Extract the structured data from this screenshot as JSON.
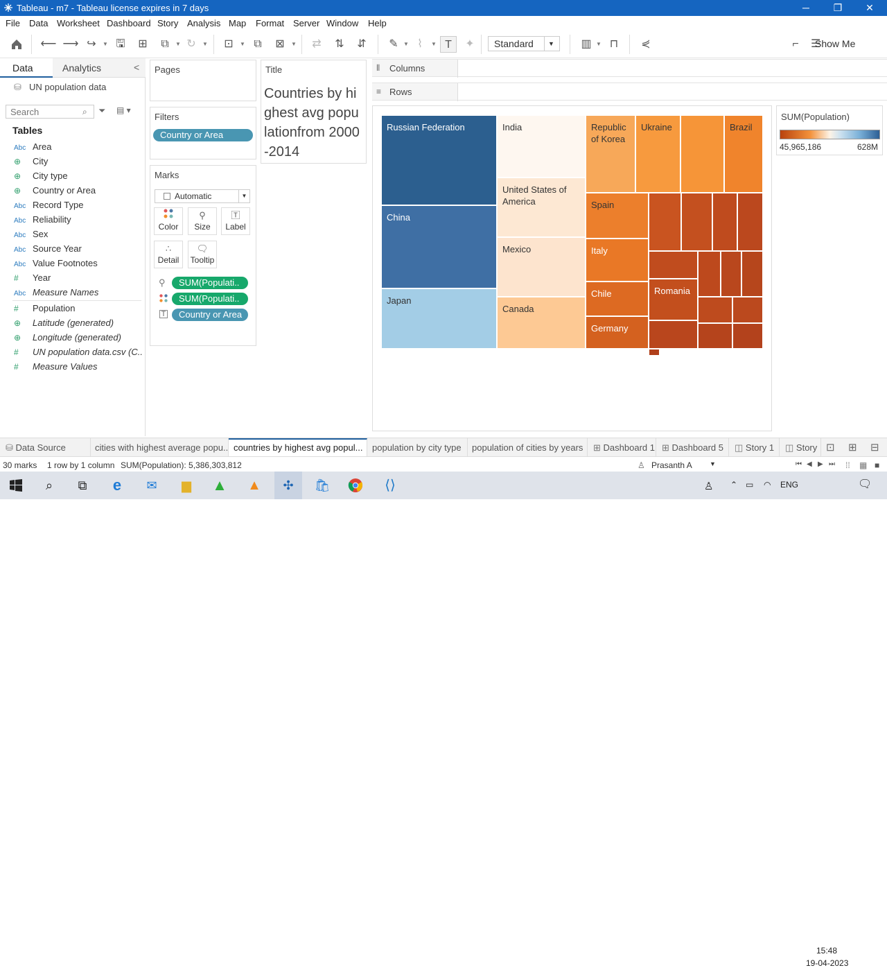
{
  "window": {
    "title": "Tableau - m7 - Tableau license expires in 7 days",
    "min": "─",
    "max": "❐",
    "close": "✕"
  },
  "menu": [
    "File",
    "Data",
    "Worksheet",
    "Dashboard",
    "Story",
    "Analysis",
    "Map",
    "Format",
    "Server",
    "Window",
    "Help"
  ],
  "toolbar": {
    "fit_select": "Standard",
    "show_me": "Show Me"
  },
  "data_pane": {
    "tab_data": "Data",
    "tab_analytics": "Analytics",
    "collapse": "<",
    "data_source": "UN population data",
    "search_placeholder": "Search",
    "tables_heading": "Tables",
    "fields": [
      {
        "type": "Abc",
        "name": "Area"
      },
      {
        "type": "globe",
        "name": "City"
      },
      {
        "type": "globe",
        "name": "City type"
      },
      {
        "type": "globe",
        "name": "Country or Area"
      },
      {
        "type": "Abc",
        "name": "Record Type"
      },
      {
        "type": "Abc",
        "name": "Reliability"
      },
      {
        "type": "Abc",
        "name": "Sex"
      },
      {
        "type": "Abc",
        "name": "Source Year"
      },
      {
        "type": "Abc",
        "name": "Value Footnotes"
      },
      {
        "type": "#",
        "name": "Year"
      },
      {
        "type": "Abc",
        "name": "Measure Names"
      },
      {
        "type": "#",
        "name": "Population"
      },
      {
        "type": "globe",
        "name": "Latitude (generated)"
      },
      {
        "type": "globe",
        "name": "Longitude (generated)"
      },
      {
        "type": "#",
        "name": "UN population data.csv (C..."
      },
      {
        "type": "#",
        "name": "Measure Values"
      }
    ]
  },
  "pages_card": {
    "title": "Pages"
  },
  "filters_card": {
    "title": "Filters",
    "pill": "Country or Area"
  },
  "marks_card": {
    "title": "Marks",
    "mark_type": "Automatic",
    "buttons": {
      "color": "Color",
      "size": "Size",
      "label": "Label",
      "detail": "Detail",
      "tooltip": "Tooltip"
    },
    "pills": [
      "SUM(Populati..",
      "SUM(Populati..",
      "Country or Area"
    ]
  },
  "title_card": {
    "header": "Title",
    "text": "Countries by highest avg populationfrom 2000-2014"
  },
  "columns_label": "Columns",
  "rows_label": "Rows",
  "legend": {
    "title": "SUM(Population)",
    "min": "45,965,186",
    "max": "628M"
  },
  "treemap": {
    "cells": [
      {
        "label": "Russian Federation",
        "color": "#2c5f8f",
        "text": "#fff"
      },
      {
        "label": "China",
        "color": "#3f6fa4",
        "text": "#fff"
      },
      {
        "label": "Japan",
        "color": "#a3cde6",
        "text": "#333"
      },
      {
        "label": "India",
        "color": "#fef7f0",
        "text": "#333"
      },
      {
        "label": "United States of America",
        "color": "#fde8d3",
        "text": "#333"
      },
      {
        "label": "Mexico",
        "color": "#fde4ce",
        "text": "#333"
      },
      {
        "label": "Canada",
        "color": "#fdc994",
        "text": "#333"
      },
      {
        "label": "Republic of Korea",
        "color": "#f7a859",
        "text": "#333"
      },
      {
        "label": "Ukraine",
        "color": "#f79a3e",
        "text": "#333"
      },
      {
        "label": "",
        "color": "#f69538",
        "text": "#333"
      },
      {
        "label": "Brazil",
        "color": "#f0842c",
        "text": "#333"
      },
      {
        "label": "Spain",
        "color": "#ec7f2c",
        "text": "#333"
      },
      {
        "label": "Italy",
        "color": "#e97826",
        "text": "#fff"
      },
      {
        "label": "Chile",
        "color": "#dd6a22",
        "text": "#fff"
      },
      {
        "label": "Germany",
        "color": "#d4611f",
        "text": "#fff"
      },
      {
        "label": "Romania",
        "color": "#c34f1d",
        "text": "#fff"
      },
      {
        "label": "",
        "color": "#c95420",
        "text": "#fff"
      },
      {
        "label": "",
        "color": "#c4501f",
        "text": "#fff"
      },
      {
        "label": "",
        "color": "#bf4b1e",
        "text": "#fff"
      },
      {
        "label": "",
        "color": "#bb481e",
        "text": "#fff"
      },
      {
        "label": "",
        "color": "#c04c1e",
        "text": "#fff"
      },
      {
        "label": "",
        "color": "#bd491d",
        "text": "#fff"
      },
      {
        "label": "",
        "color": "#b9471d",
        "text": "#fff"
      },
      {
        "label": "",
        "color": "#b6461c",
        "text": "#fff"
      },
      {
        "label": "",
        "color": "#be4b1e",
        "text": "#fff"
      },
      {
        "label": "",
        "color": "#bb491e",
        "text": "#fff"
      },
      {
        "label": "",
        "color": "#b9461d",
        "text": "#fff"
      },
      {
        "label": "",
        "color": "#b5441c",
        "text": "#fff"
      },
      {
        "label": "",
        "color": "#b3421c",
        "text": "#fff"
      },
      {
        "label": "",
        "color": "#b0401b",
        "text": "#fff"
      }
    ]
  },
  "sheet_tabs": [
    {
      "label": "Data Source",
      "icon": "datasource-icon"
    },
    {
      "label": "cities with highest average popu..."
    },
    {
      "label": "countries by highest avg popul...",
      "active": true
    },
    {
      "label": "population by city type"
    },
    {
      "label": "population of cities by years"
    },
    {
      "label": "Dashboard 1",
      "icon": "dashboard-icon"
    },
    {
      "label": "Dashboard 5",
      "icon": "dashboard-icon"
    },
    {
      "label": "Story 1",
      "icon": "story-icon"
    },
    {
      "label": "Story",
      "icon": "story-icon"
    }
  ],
  "status": {
    "marks": "30 marks",
    "rows_cols": "1 row by 1 column",
    "sum": "SUM(Population): 5,386,303,812",
    "user": "Prasanth A"
  },
  "taskbar": {
    "lang": "ENG",
    "time": "15:48",
    "date": "19-04-2023"
  }
}
